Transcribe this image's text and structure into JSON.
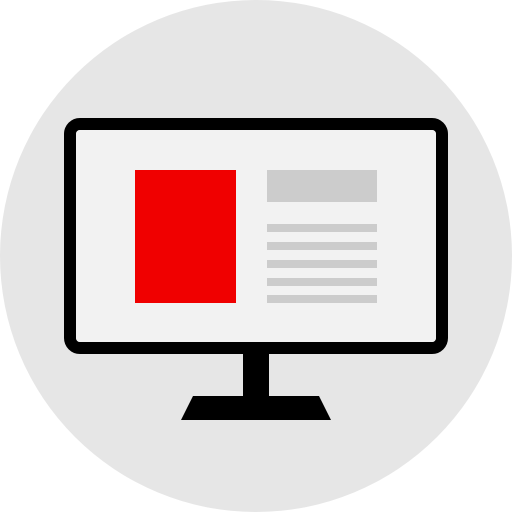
{
  "icon": {
    "name": "computer-monitor-with-article-icon",
    "colors": {
      "background_circle": "#e6e6e6",
      "screen": "#f2f2f2",
      "frame": "#000000",
      "image_placeholder": "#f00000",
      "text_placeholder": "#cccccc"
    },
    "text_line_count": 5
  }
}
